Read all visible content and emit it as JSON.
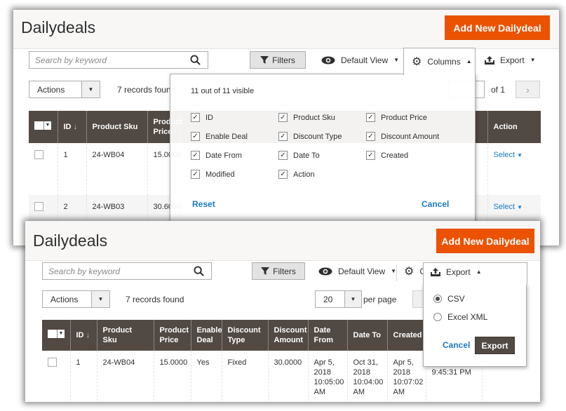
{
  "colors": {
    "accent": "#eb5202",
    "header_bg": "#514943",
    "link": "#1979c3"
  },
  "shot1": {
    "title": "Dailydeals",
    "add_button": "Add New Dailydeal",
    "search_placeholder": "Search by keyword",
    "filters": "Filters",
    "default_view": "Default View",
    "columns": "Columns",
    "export": "Export",
    "actions": "Actions",
    "records": "7 records found",
    "pages": "of 1",
    "columns_panel": {
      "visible_count": "11 out of 11 visible",
      "options": [
        {
          "label": "ID",
          "checked": true
        },
        {
          "label": "Product Sku",
          "checked": true
        },
        {
          "label": "Product Price",
          "checked": true
        },
        {
          "label": "Enable Deal",
          "checked": true
        },
        {
          "label": "Discount Type",
          "checked": true
        },
        {
          "label": "Discount Amount",
          "checked": true
        },
        {
          "label": "Date From",
          "checked": true
        },
        {
          "label": "Date To",
          "checked": true
        },
        {
          "label": "Created",
          "checked": true
        },
        {
          "label": "Modified",
          "checked": true
        },
        {
          "label": "Action",
          "checked": true
        }
      ],
      "reset": "Reset",
      "cancel": "Cancel"
    },
    "table": {
      "headers": [
        "ID",
        "Product Sku",
        "Product Price",
        "Action"
      ],
      "rows": [
        {
          "id": "1",
          "sku": "24-WB04",
          "price": "15.0000",
          "action": "Select"
        },
        {
          "id": "2",
          "sku": "24-WB03",
          "price": "30.6000",
          "action": "Select"
        }
      ]
    }
  },
  "shot2": {
    "title": "Dailydeals",
    "add_button": "Add New Dailydeal",
    "search_placeholder": "Search by keyword",
    "filters": "Filters",
    "default_view": "Default View",
    "columns": "Columns",
    "export": "Export",
    "actions": "Actions",
    "records": "7 records found",
    "per_page_value": "20",
    "per_page_label": "per page",
    "export_panel": {
      "options": [
        {
          "label": "CSV",
          "selected": true
        },
        {
          "label": "Excel XML",
          "selected": false
        }
      ],
      "cancel": "Cancel",
      "export": "Export"
    },
    "table": {
      "headers": [
        "ID",
        "Product Sku",
        "Product Price",
        "Enable Deal",
        "Discount Type",
        "Discount Amount",
        "Date From",
        "Date To",
        "Created"
      ],
      "rows": [
        {
          "id": "1",
          "sku": "24-WB04",
          "price": "15.0000",
          "enable": "Yes",
          "type": "Fixed",
          "amount": "30.0000",
          "date_from": "Apr 5, 2018 10:05:00 AM",
          "date_to": "Oct 31, 2018 10:04:00 AM",
          "created": "Apr 5, 2018 10:07:02 AM",
          "modified": "Apr 15, 2018 9:45:31 PM"
        }
      ]
    }
  }
}
